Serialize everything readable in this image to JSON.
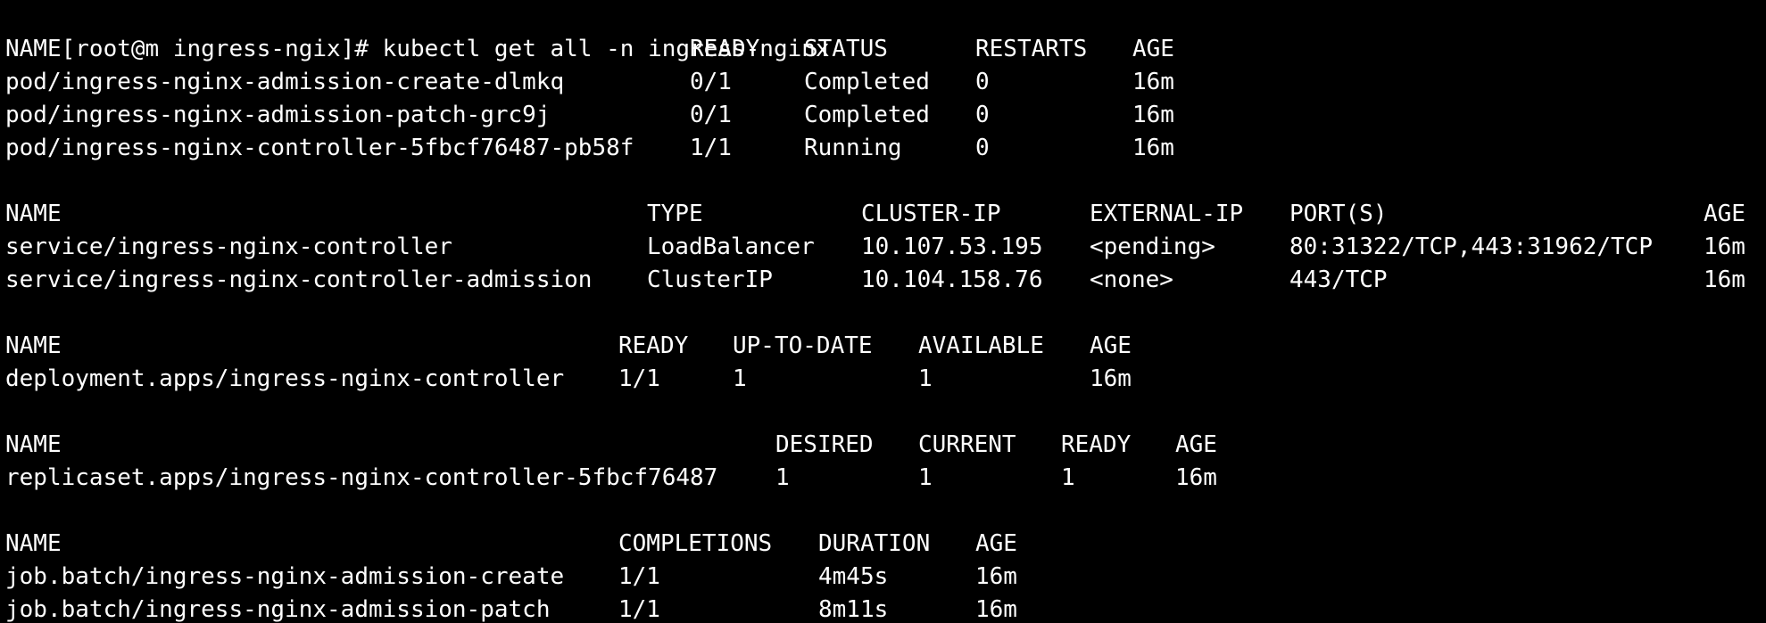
{
  "prompt": {
    "text": "[root@m ingress-ngix]# ",
    "command": "kubectl get all -n ingress-nginx"
  },
  "sections": [
    {
      "id": "pods",
      "headers": [
        "NAME",
        "READY",
        "STATUS",
        "RESTARTS",
        "AGE"
      ],
      "rows": [
        [
          "pod/ingress-nginx-admission-create-dlmkq",
          "0/1",
          "Completed",
          "0",
          "16m"
        ],
        [
          "pod/ingress-nginx-admission-patch-grc9j",
          "0/1",
          "Completed",
          "0",
          "16m"
        ],
        [
          "pod/ingress-nginx-controller-5fbcf76487-pb58f",
          "1/1",
          "Running",
          "0",
          "16m"
        ]
      ]
    },
    {
      "id": "services",
      "headers": [
        "NAME",
        "TYPE",
        "CLUSTER-IP",
        "EXTERNAL-IP",
        "PORT(S)",
        "AGE"
      ],
      "rows": [
        [
          "service/ingress-nginx-controller",
          "LoadBalancer",
          "10.107.53.195",
          "<pending>",
          "80:31322/TCP,443:31962/TCP",
          "16m"
        ],
        [
          "service/ingress-nginx-controller-admission",
          "ClusterIP",
          "10.104.158.76",
          "<none>",
          "443/TCP",
          "16m"
        ]
      ]
    },
    {
      "id": "deployments",
      "headers": [
        "NAME",
        "READY",
        "UP-TO-DATE",
        "AVAILABLE",
        "AGE"
      ],
      "rows": [
        [
          "deployment.apps/ingress-nginx-controller",
          "1/1",
          "1",
          "1",
          "16m"
        ]
      ]
    },
    {
      "id": "replicasets",
      "headers": [
        "NAME",
        "DESIRED",
        "CURRENT",
        "READY",
        "AGE"
      ],
      "rows": [
        [
          "replicaset.apps/ingress-nginx-controller-5fbcf76487",
          "1",
          "1",
          "1",
          "16m"
        ]
      ]
    },
    {
      "id": "jobs",
      "headers": [
        "NAME",
        "COMPLETIONS",
        "DURATION",
        "AGE"
      ],
      "rows": [
        [
          "job.batch/ingress-nginx-admission-create",
          "1/1",
          "4m45s",
          "16m"
        ],
        [
          "job.batch/ingress-nginx-admission-patch",
          "1/1",
          "8m11s",
          "16m"
        ]
      ]
    }
  ]
}
